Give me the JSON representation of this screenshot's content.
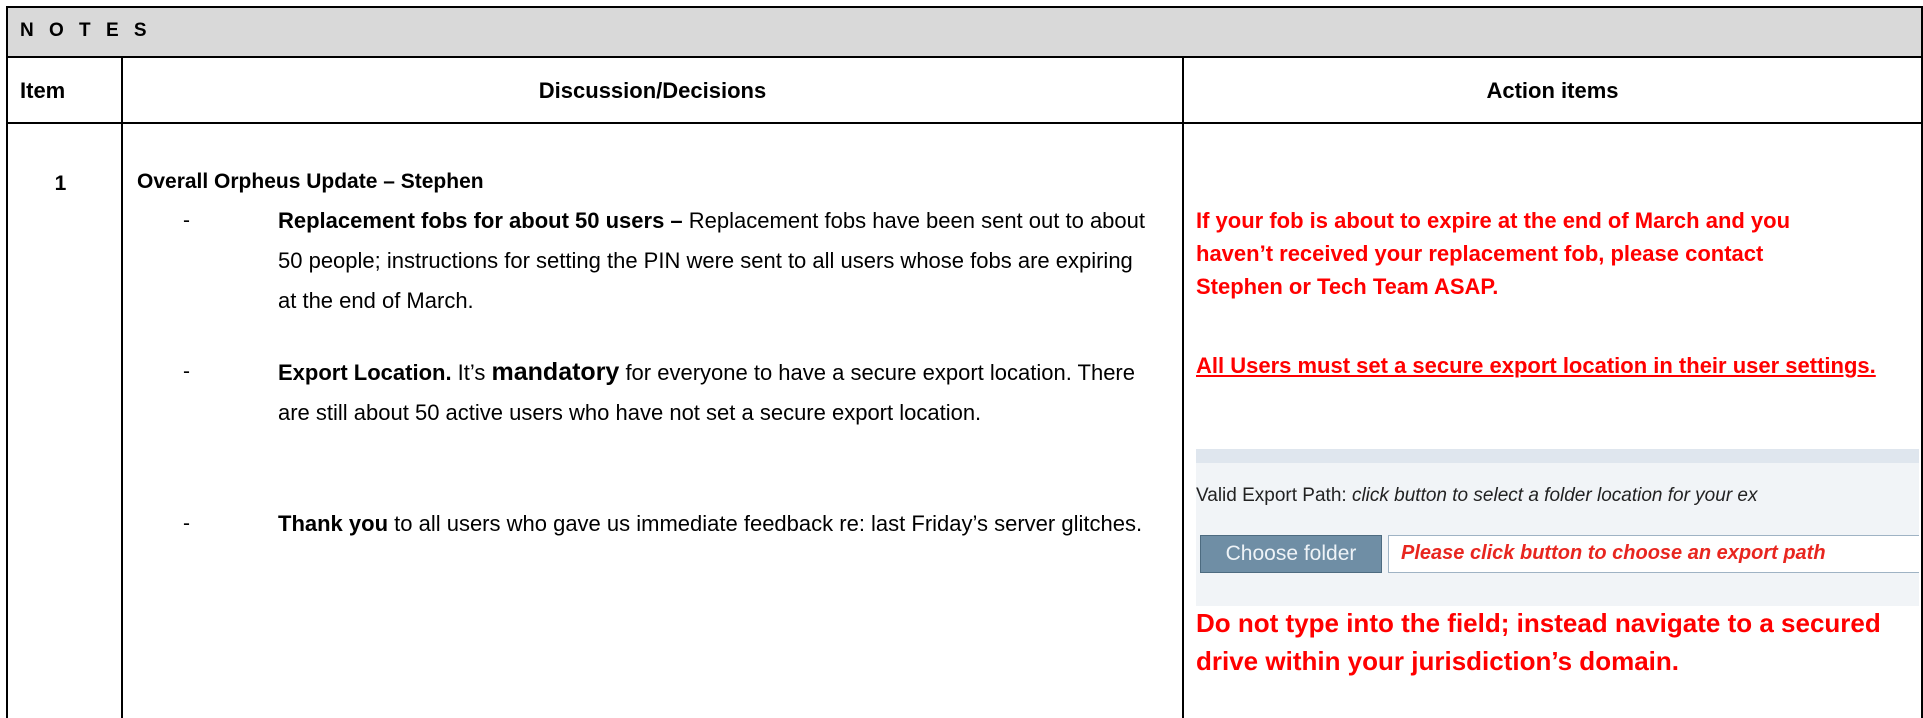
{
  "header": {
    "title": "N O T E S"
  },
  "columns": {
    "item": "Item",
    "discussion": "Discussion/Decisions",
    "actions": "Action items"
  },
  "rows": [
    {
      "item": "1",
      "section_title": "Overall Orpheus Update – Stephen",
      "bullets": [
        {
          "lead": "Replacement fobs for about 50 users –",
          "body": " Replacement fobs have been sent out to about 50 people; instructions for setting the PIN were sent to all users whose fobs are expiring at the end of March."
        },
        {
          "lead": "Export Location.",
          "mid": " It’s ",
          "emph": "mandatory",
          "body": " for everyone to have a secure export location. There are still about 50 active users who have not set a secure export location."
        },
        {
          "lead": "Thank you",
          "body": " to all users who gave us immediate feedback re: last Friday’s server glitches."
        }
      ],
      "bullet_marker": "-",
      "actions": {
        "p1": "If your fob is about to expire at the end of March and you haven’t received your replacement fob, please contact Stephen or Tech Team ASAP.",
        "p2": "All Users must set a secure export location in their user settings.",
        "embed": {
          "label_prefix": "Valid Export Path: ",
          "label_italic": "click button to select a folder location for your ex",
          "button": "Choose folder",
          "field_value": "Please click button to choose an export path"
        },
        "p3": "Do not type into the field; instead navigate to a secured drive within your jurisdiction’s domain."
      }
    }
  ],
  "colors": {
    "header_bg": "#d9d9d9",
    "action_red": "#ff0000",
    "button_bg": "#6f8ea5",
    "field_text": "#e8261f"
  }
}
